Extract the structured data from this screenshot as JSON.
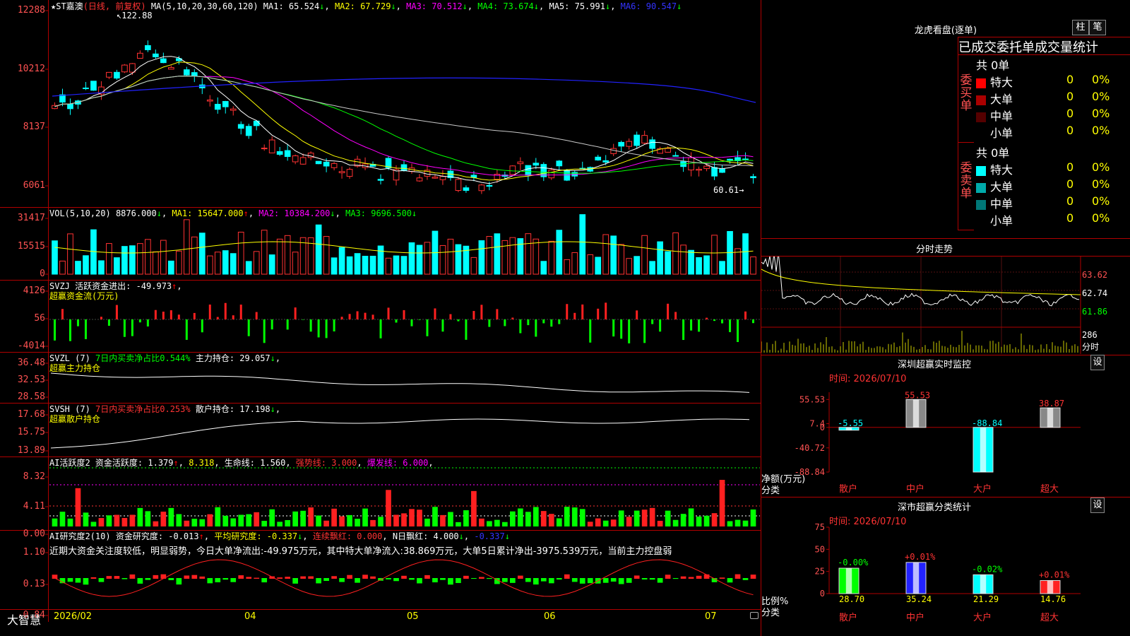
{
  "stock": {
    "name": "★ST嘉澳",
    "mode": "(日线, 前复权)"
  },
  "main": {
    "ma_param": "MA(5,10,20,30,60,120)",
    "ma": [
      {
        "label": "MA1: 65.524",
        "arrow": "↓",
        "color": "#ffffff"
      },
      {
        "label": "MA2: 67.729",
        "arrow": "↓",
        "color": "#ffff00"
      },
      {
        "label": "MA3: 70.512",
        "arrow": "↓",
        "color": "#ff00ff"
      },
      {
        "label": "MA4: 73.674",
        "arrow": "↓",
        "color": "#00ff00"
      },
      {
        "label": "MA5: 75.991",
        "arrow": "↓",
        "color": "#ffffff"
      },
      {
        "label": "MA6: 90.547",
        "arrow": "↓",
        "color": "#3333ff"
      }
    ],
    "y_ticks": [
      "12288",
      "10212",
      "8137",
      "6061"
    ],
    "high_label": "122.88",
    "low_label": "60.61→"
  },
  "vol": {
    "header": "VOL(5,10,20)",
    "v": "8876.000",
    "v_arrow": "↓",
    "ma1": "MA1: 15647.000",
    "ma1_arrow": "↑",
    "ma2": "MA2: 10384.200",
    "ma2_arrow": "↓",
    "ma3": "MA3: 9696.500",
    "ma3_arrow": "↓",
    "y_ticks": [
      "31417",
      "15515",
      "0"
    ]
  },
  "svzj": {
    "header": "SVZJ  活跃资金进出: -49.973",
    "arrow": "↑",
    "comma": ",",
    "sub": "超赢资金流(万元)",
    "y_ticks": [
      "4126",
      "56",
      "-4014"
    ]
  },
  "svzl": {
    "header": "SVZL (7)",
    "h2": "7日内买卖净占比0.544%",
    "h3": "主力持仓: 29.057",
    "arrow": "↓",
    "comma": ",",
    "sub": "超赢主力持仓",
    "y_ticks": [
      "36.48",
      "32.53",
      "28.58"
    ]
  },
  "svsh": {
    "header": "SVSH (7)",
    "h2": "7日内买卖净占比0.253%",
    "h3": "散户持仓: 17.198",
    "arrow": "↓",
    "comma": ",",
    "sub": "超赢散户持仓",
    "y_ticks": [
      "17.68",
      "15.75",
      "13.89"
    ]
  },
  "ai1": {
    "header": "AI活跃度2",
    "h1": "资金活跃度: 1.379",
    "a1": "↑",
    "h2": "8.318",
    "h3": "生命线: 1.560",
    "h4": "强势线: 3.000",
    "h5": "爆发线: 6.000",
    "comma": ",",
    "y_ticks": [
      "8.32",
      "4.11",
      "0.00"
    ]
  },
  "ai2": {
    "header": "AI研究度2(10)",
    "h1": "资金研究度: -0.013",
    "a1": "↑",
    "h2": "平均研究度: -0.337",
    "a2": "↓",
    "h3": "连续飘红: 0.000",
    "h4": "N日飘红: 4.000",
    "a4": "↓",
    "h5": "-0.337",
    "a5": "↓",
    "comma": ",",
    "comment": "近期大资金关注度较低，明显弱势，今日大单净流出:-49.975万元，其中特大单净流入:38.869万元，大单5日累计净出-3975.539万元，当前主力控盘弱",
    "y_ticks": [
      "1.10",
      "0.13",
      "-0.84"
    ]
  },
  "xaxis": {
    "labels": [
      "2026/02",
      "04",
      "05",
      "06",
      "07"
    ]
  },
  "brand": "大智慧",
  "right": {
    "lhkp": {
      "title": "龙虎看盘(逐单)",
      "btn1": "柱",
      "btn2": "笔",
      "stats_title": "已成交委托单成交量统计",
      "buy": {
        "side": "委买单",
        "total": "共 0单",
        "rows": [
          {
            "label": "特大",
            "v": "0",
            "p": "0%",
            "color": "#ff0000"
          },
          {
            "label": "大单",
            "v": "0",
            "p": "0%",
            "color": "#aa0000"
          },
          {
            "label": "中单",
            "v": "0",
            "p": "0%",
            "color": "#550000"
          },
          {
            "label": "小单",
            "v": "0",
            "p": "0%",
            "color": "#000000"
          }
        ]
      },
      "sell": {
        "side": "委卖单",
        "total": "共 0单",
        "rows": [
          {
            "label": "特大",
            "v": "0",
            "p": "0%",
            "color": "#00ffff"
          },
          {
            "label": "大单",
            "v": "0",
            "p": "0%",
            "color": "#00aaaa"
          },
          {
            "label": "中单",
            "v": "0",
            "p": "0%",
            "color": "#007777"
          },
          {
            "label": "小单",
            "v": "0",
            "p": "0%",
            "color": "#000000"
          }
        ]
      }
    },
    "fs": {
      "title": "分时走势",
      "y_ticks": [
        "63.62",
        "62.74",
        "61.86"
      ],
      "vol_ticks": [
        "286",
        "分时"
      ]
    },
    "szjk": {
      "title": "深圳超赢实时监控",
      "btn": "设",
      "time": "时间: 2026/07/10",
      "y_ticks": [
        "55.53",
        "7.4",
        "0",
        "-40.72",
        "-88.84"
      ],
      "ylabel1": "净额(万元)",
      "ylabel2": "分类",
      "categories": [
        "散户",
        "中户",
        "大户",
        "超大"
      ],
      "values": [
        -5.55,
        55.53,
        -88.84,
        38.87
      ],
      "value_labels": [
        "-5.55",
        "55.53",
        "-88.84",
        "38.87"
      ]
    },
    "szfl": {
      "title": "深市超赢分类统计",
      "btn": "设",
      "time": "时间: 2026/07/10",
      "y_ticks": [
        "75",
        "50",
        "25",
        "0"
      ],
      "ylabel1": "比例%",
      "ylabel2": "分类",
      "categories": [
        "散户",
        "中户",
        "大户",
        "超大"
      ],
      "values": [
        28.7,
        35.24,
        21.29,
        14.76
      ],
      "value_labels": [
        "28.70",
        "35.24",
        "21.29",
        "14.76"
      ],
      "delta": [
        "-0.00%",
        "+0.01%",
        "-0.02%",
        "+0.01%"
      ]
    }
  }
}
